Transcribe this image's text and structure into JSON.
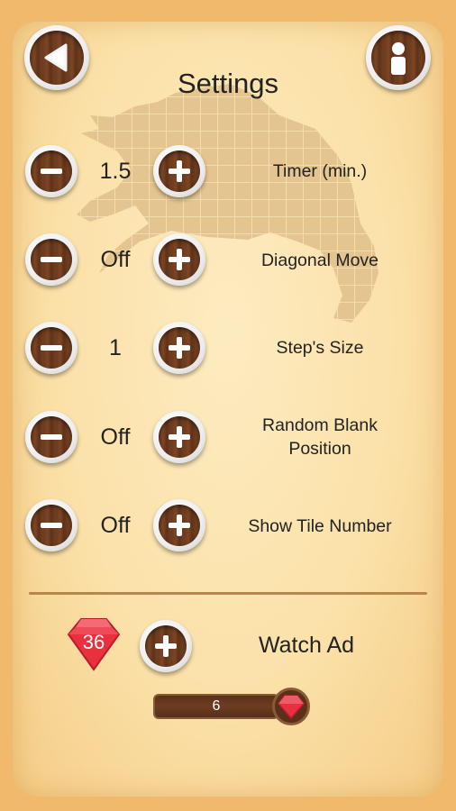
{
  "title": "Settings",
  "settings": [
    {
      "name": "timer",
      "label": "Timer (min.)",
      "value": "1.5"
    },
    {
      "name": "diagonal-move",
      "label": "Diagonal Move",
      "value": "Off"
    },
    {
      "name": "steps-size",
      "label": "Step's Size",
      "value": "1"
    },
    {
      "name": "random-blank-position",
      "label": "Random Blank Position",
      "value": "Off"
    },
    {
      "name": "show-tile-number",
      "label": "Show Tile Number",
      "value": "Off"
    }
  ],
  "gems": {
    "count": "36",
    "watch_ad_label": "Watch Ad",
    "progress_value": "6"
  },
  "colors": {
    "background": "#f1b96c",
    "panel": "#fbe1a9",
    "wood": "#6b3a1e",
    "gem": "#e8303f"
  }
}
